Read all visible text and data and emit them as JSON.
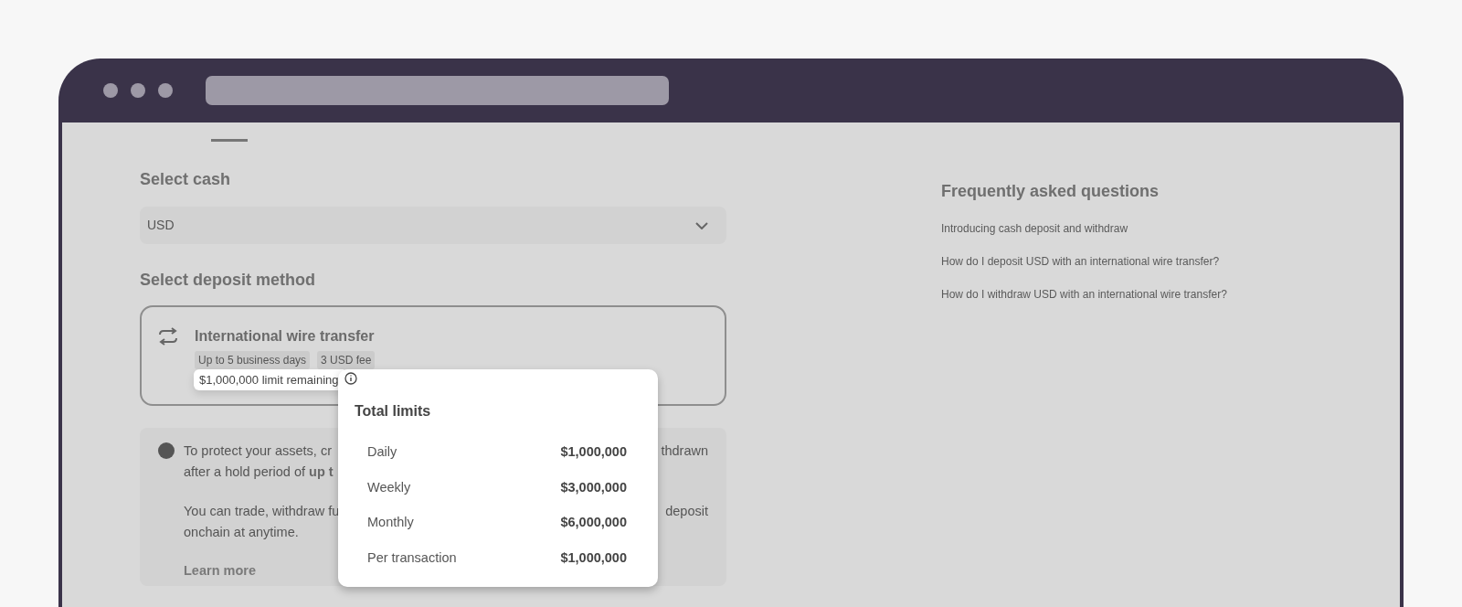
{
  "deposit_form": {
    "cash_label": "Select cash",
    "cash_value": "USD",
    "method_label": "Select deposit method",
    "method": {
      "title": "International wire transfer",
      "tags": [
        "Up to 5 business days",
        "3 USD fee"
      ],
      "limit_badge": "$1,000,000 limit remaining"
    },
    "notice": {
      "lines": [
        {
          "left": "To protect your assets, cr",
          "right": "thdrawn"
        },
        {
          "left": "after a hold period of **up t**"
        },
        {
          "left": "You can trade, withdraw fu",
          "right": "deposit"
        },
        {
          "left": "onchain at anytime."
        }
      ],
      "link": "Learn more"
    }
  },
  "limits_popover": {
    "title": "Total limits",
    "rows": [
      {
        "label": "Daily",
        "value": "$1,000,000"
      },
      {
        "label": "Weekly",
        "value": "$3,000,000"
      },
      {
        "label": "Monthly",
        "value": "$6,000,000"
      },
      {
        "label": "Per transaction",
        "value": "$1,000,000"
      }
    ]
  },
  "faq": {
    "title": "Frequently asked questions",
    "items": [
      "Introducing cash deposit and withdraw",
      "How do I deposit USD with an international wire transfer?",
      "How do I withdraw USD with an international wire transfer?"
    ]
  }
}
